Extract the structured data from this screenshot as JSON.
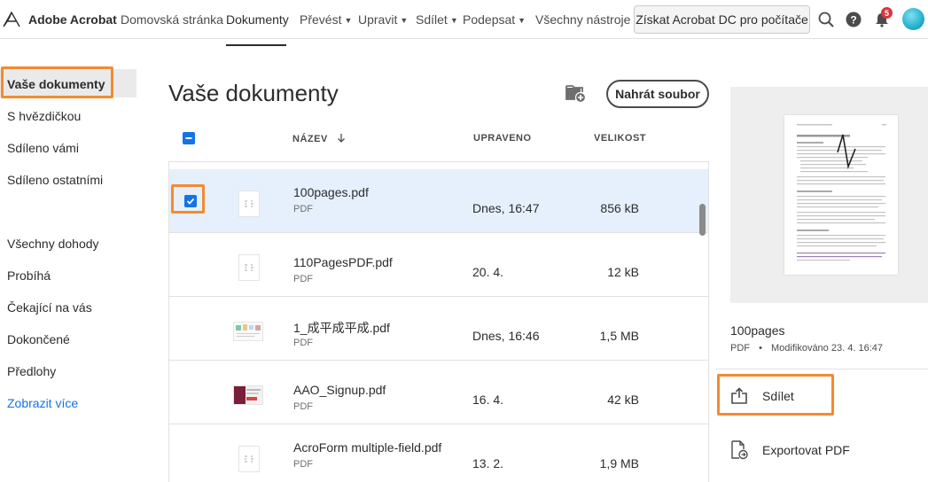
{
  "app": {
    "brand": "Adobe Acrobat"
  },
  "nav": {
    "home": "Domovská stránka",
    "documents": "Dokumenty",
    "convert": "Převést",
    "edit": "Upravit",
    "share": "Sdílet",
    "sign": "Podepsat",
    "all_tools": "Všechny nástroje",
    "get_desktop": "Získat Acrobat DC pro počítače",
    "notification_count": "5"
  },
  "sidebar": {
    "items": [
      {
        "label": "Vaše dokumenty"
      },
      {
        "label": "S hvězdičkou"
      },
      {
        "label": "Sdíleno vámi"
      },
      {
        "label": "Sdíleno ostatními"
      },
      {
        "label": "Všechny dohody"
      },
      {
        "label": "Probíhá"
      },
      {
        "label": "Čekající na vás"
      },
      {
        "label": "Dokončené"
      },
      {
        "label": "Předlohy"
      }
    ],
    "show_more": "Zobrazit více"
  },
  "main": {
    "title": "Vaše dokumenty",
    "upload": "Nahrát soubor",
    "columns": {
      "name": "NÁZEV",
      "modified": "UPRAVENO",
      "size": "VELIKOST"
    },
    "rows": [
      {
        "name": "100pages.pdf",
        "type": "PDF",
        "modified": "Dnes, 16:47",
        "size": "856 kB"
      },
      {
        "name": "110PagesPDF.pdf",
        "type": "PDF",
        "modified": "20. 4.",
        "size": "12 kB"
      },
      {
        "name": "1_成平成平成.pdf",
        "type": "PDF",
        "modified": "Dnes, 16:46",
        "size": "1,5 MB"
      },
      {
        "name": "AAO_Signup.pdf",
        "type": "PDF",
        "modified": "16. 4.",
        "size": "42 kB"
      },
      {
        "name": "AcroForm multiple-field.pdf",
        "type": "PDF",
        "modified": "13. 2.",
        "size": "1,9 MB"
      }
    ]
  },
  "panel": {
    "doc_name": "100pages",
    "doc_type": "PDF",
    "separator": "•",
    "modified_label": "Modifikováno",
    "modified_value": "23. 4. 16:47",
    "share": "Sdílet",
    "export": "Exportovat PDF"
  },
  "colors": {
    "accent": "#1473e6",
    "highlight": "#f28b30",
    "selected_row": "#e5f0fc",
    "badge": "#d7373f"
  }
}
